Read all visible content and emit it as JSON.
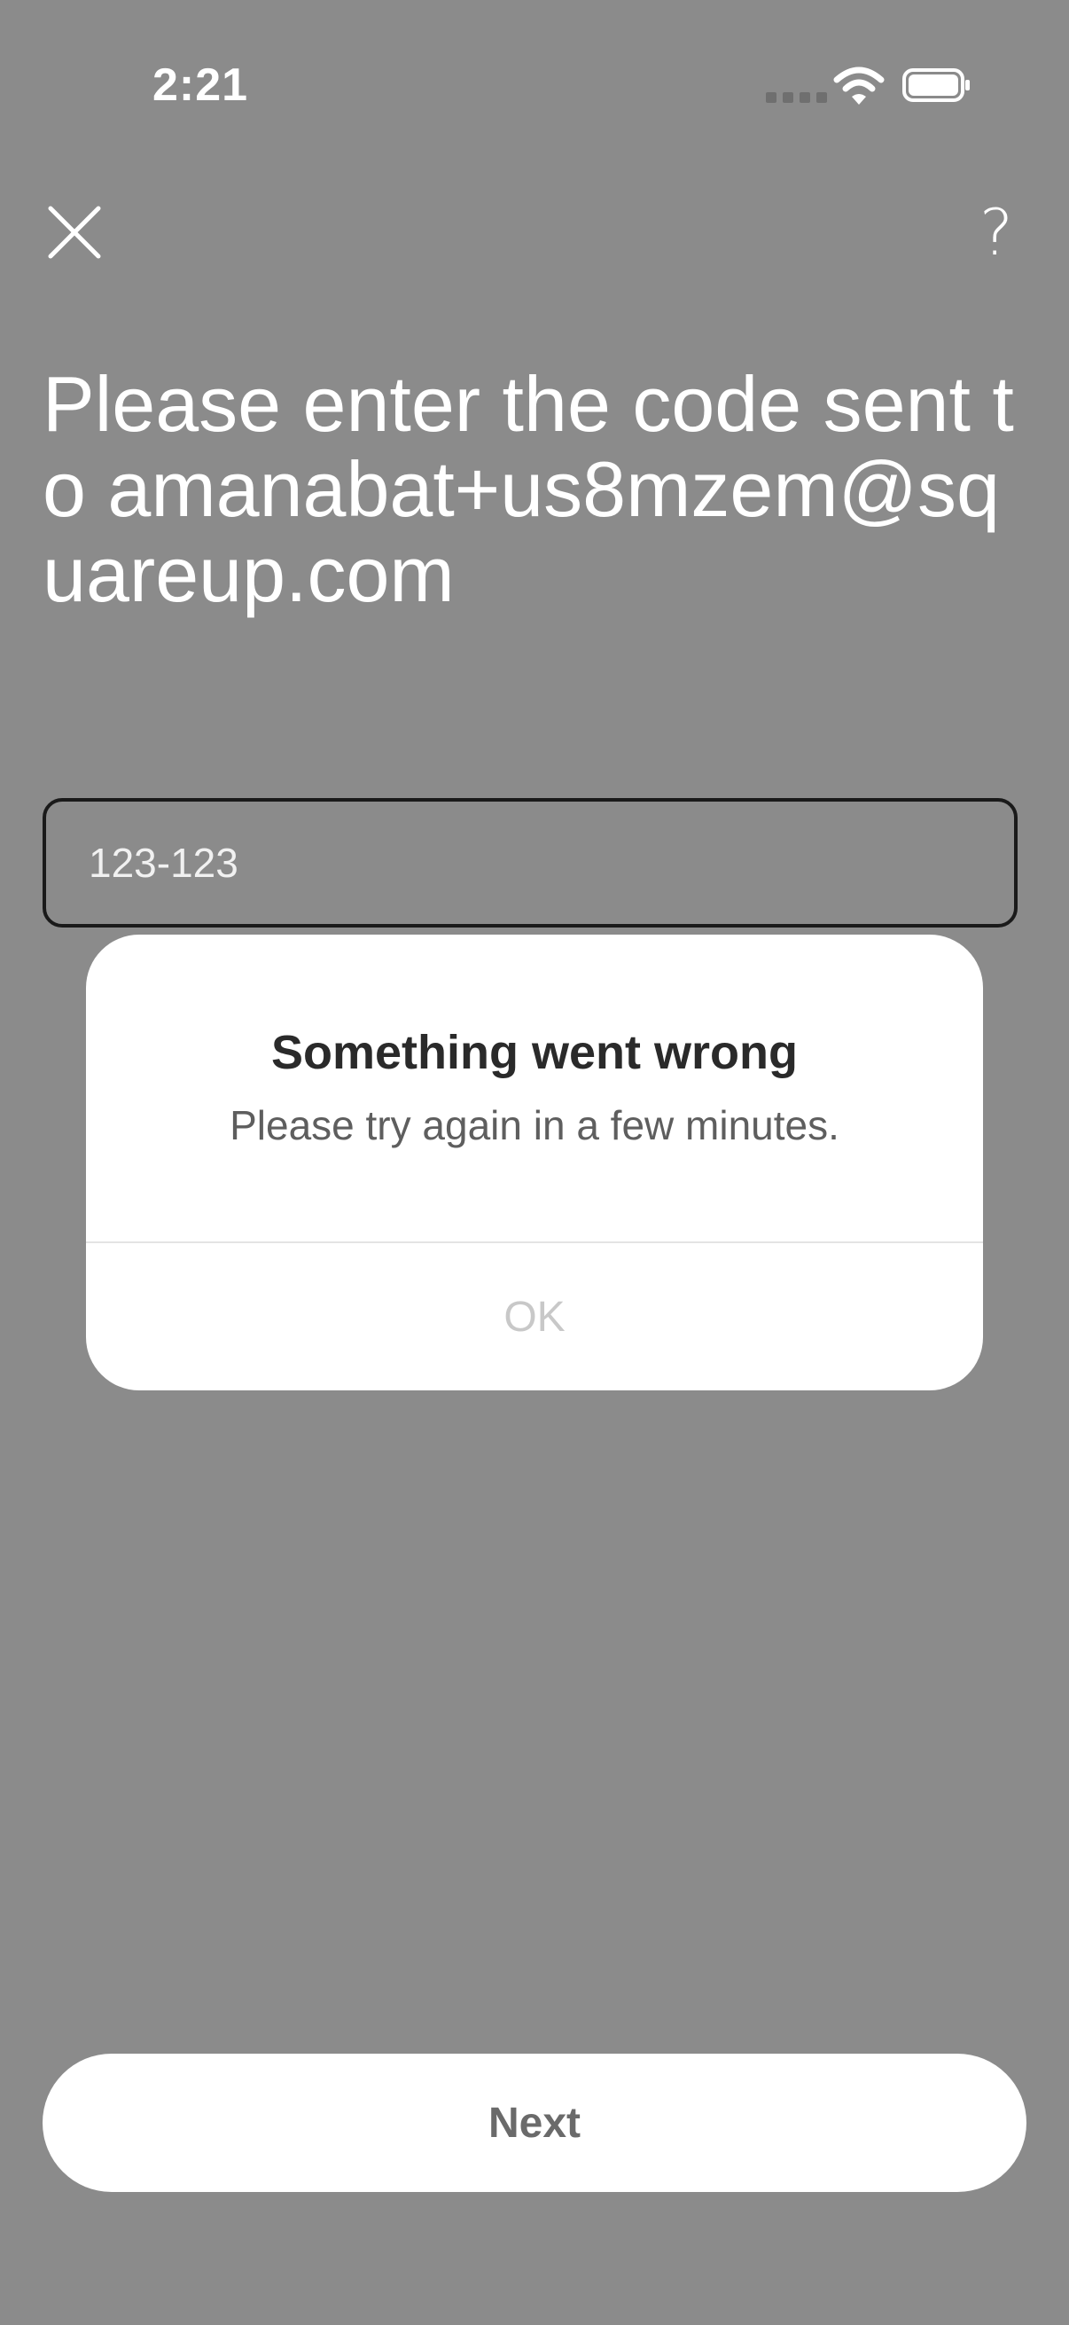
{
  "status_bar": {
    "time": "2:21"
  },
  "nav": {
    "close_icon": "close-icon",
    "help_icon": "help-icon",
    "help_glyph": "?"
  },
  "heading": {
    "text": "Please enter the code sent to amanabat+us8mzem@squareup.com"
  },
  "code_input": {
    "placeholder": "123-123",
    "value": ""
  },
  "dialog": {
    "title": "Something went wrong",
    "message": "Please try again in a few minutes.",
    "ok_label": "OK"
  },
  "next_button": {
    "label": "Next"
  },
  "colors": {
    "overlay_background": "#8b8b8b",
    "dialog_background": "#ffffff",
    "input_border": "#1a1a1a"
  }
}
